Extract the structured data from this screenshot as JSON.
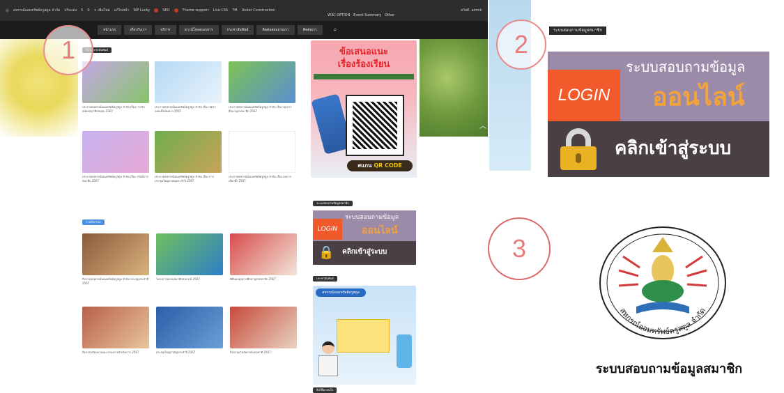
{
  "admin_bar": {
    "items": [
      "สหกรณ์ออมทรัพย์ครูสตูล จำกัด",
      "ปรับแต่ง",
      "5",
      "0",
      "+ เพิ่มใหม่",
      "แก้ไขหน้า",
      "WP Lucky",
      "SEO",
      "Theme support",
      "Live CSS",
      "TM",
      "Under Construction"
    ],
    "right_label": "สวัสดี, admin",
    "sub_items": [
      "W3C OPTION",
      "Event Summary",
      "Other"
    ]
  },
  "nav": {
    "items": [
      "หน้าแรก",
      "เกี่ยวกับเรา",
      "บริการ",
      "ดาวน์โหลดเอกสาร",
      "ประชาสัมพันธ์",
      "ติดต่อสอบถามเรา",
      "ติดต่อเรา"
    ]
  },
  "sections": {
    "news_badge": "ข่าวประชาสัมพันธ์",
    "activity_badge": "ภาพกิจกรรม",
    "login_badge": "ระบบสอบถามข้อมูลสมาชิก",
    "promo_badge": "ประชาสัมพันธ์",
    "bottom_badge": "ลิงก์ที่น่าสนใจ"
  },
  "news_cards": [
    {
      "caption": "ประกาศสหกรณ์ออมทรัพย์ครูสตูล จำกัด เรื่อง การรับสมัครสมาชิกสมทบ 2567"
    },
    {
      "caption": "ประกาศสหกรณ์ออมทรัพย์ครูสตูล จำกัด เรื่อง อัตราดอกเบี้ยเงินฝาก 2567"
    },
    {
      "caption": "ประกาศสหกรณ์ออมทรัพย์ครูสตูล จำกัด เรื่อง ทุนการศึกษาบุตรสมาชิก 2567"
    },
    {
      "caption": "ประกาศสหกรณ์ออมทรัพย์ครูสตูล จำกัด เรื่อง สวัสดิการสมาชิก 2567"
    },
    {
      "caption": "ประกาศสหกรณ์ออมทรัพย์ครูสตูล จำกัด เรื่อง การประชุมใหญ่สามัญประจำปี 2567"
    },
    {
      "caption": "ประกาศสหกรณ์ออมทรัพย์ครูสตูล จำกัด เรื่อง ผลการเลือกตั้ง 2567"
    }
  ],
  "activity_cards": [
    {
      "caption": "กิจกรรมสหกรณ์ออมทรัพย์ครูสตูล จำกัด ประชุมประจำปี 2567"
    },
    {
      "caption": "โครงการอบรมสมาชิกสหกรณ์ 2567"
    },
    {
      "caption": "พิธีมอบทุนการศึกษาบุตรสมาชิก 2567"
    },
    {
      "caption": "กิจกรรมสัมมนาคณะกรรมการดำเนินการ 2567"
    },
    {
      "caption": "ประชุมใหญ่สามัญประจำปี 2567"
    },
    {
      "caption": "กิจกรรมวันสหกรณ์แห่งชาติ 2567"
    }
  ],
  "qr_banner": {
    "title_line1": "ข้อเสนอแนะ",
    "title_line2": "เรื่องร้องเรียน",
    "scan_prefix": "สแกน",
    "scan_code": "QR CODE"
  },
  "login_banner": {
    "section_title": "ระบบสอบถามข้อมูลสมาชิก",
    "login_label": "LOGIN",
    "line1": "ระบบสอบถามข้อมูล",
    "line2": "ออนไลน์",
    "button": "คลิกเข้าสู่ระบบ"
  },
  "promo_box": {
    "header": "สหกรณ์ออมทรัพย์ครูสตูล"
  },
  "callouts": [
    "1",
    "2",
    "3"
  ],
  "seal_caption": "ระบบสอบถามข้อมูลสมาชิก",
  "seal_ring_text": "สหกรณ์ออมทรัพย์ครูสตูล จำกัด",
  "colors": {
    "login_orange": "#f25a2b",
    "banner_purple": "#9c8aa9",
    "banner_dark": "#4a3f45",
    "online_gold": "#f4a33a",
    "callout_red": "#e77b7b"
  }
}
